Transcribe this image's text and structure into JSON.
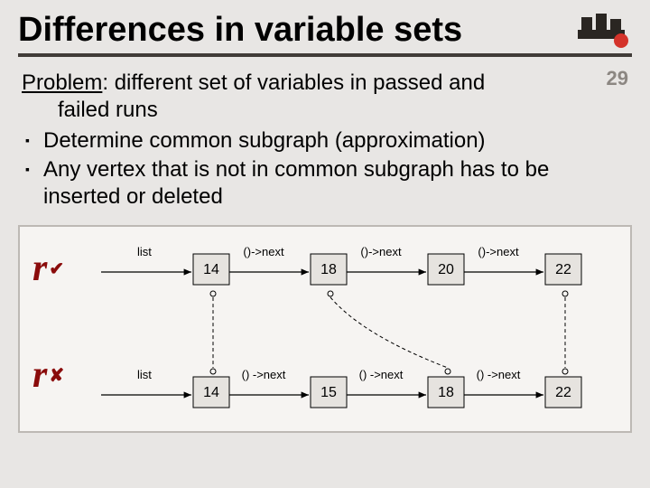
{
  "slide": {
    "title": "Differences in variable sets",
    "page_number": "29",
    "problem_label": "Problem",
    "problem_text": ": different set of variables in passed and",
    "problem_text_cont": "failed runs",
    "bullets": [
      "Determine common subgraph (approximation)",
      "Any vertex that is not in common subgraph has to be inserted or deleted"
    ]
  },
  "diagram": {
    "r_pass_symbol": "r",
    "r_fail_symbol": "r",
    "pass_mark": "✔",
    "fail_mark": "✘",
    "labels": {
      "list": "list",
      "next1": "()->next",
      "next2": "()->next",
      "next3": "()->next",
      "next4": "() ->next"
    },
    "top_nodes": [
      "14",
      "18",
      "20",
      "22"
    ],
    "bottom_nodes": [
      "14",
      "15",
      "18",
      "22"
    ]
  }
}
